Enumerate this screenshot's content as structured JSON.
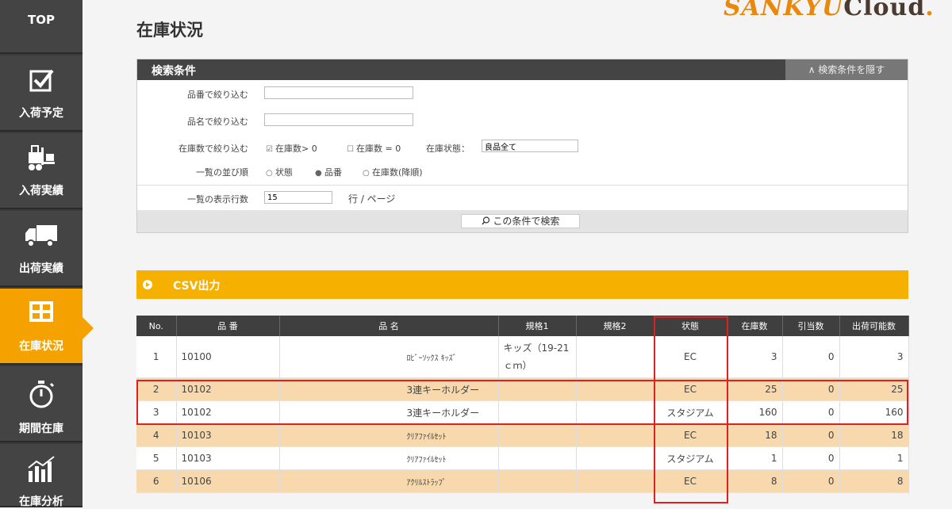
{
  "sidebar": {
    "items": [
      {
        "label": "TOP",
        "icon": "top"
      },
      {
        "label": "入荷予定",
        "icon": "checkbox-icon"
      },
      {
        "label": "入荷実績",
        "icon": "forklift-icon"
      },
      {
        "label": "出荷実績",
        "icon": "truck-icon"
      },
      {
        "label": "在庫状況",
        "icon": "grid-icon",
        "active": true
      },
      {
        "label": "期間在庫",
        "icon": "stopwatch-icon"
      },
      {
        "label": "在庫分析",
        "icon": "bar-chart-icon"
      }
    ]
  },
  "logo": {
    "part1": "SANKYU",
    "part2": "Cloud",
    "dot": "."
  },
  "page_title": "在庫状況",
  "search_panel": {
    "title": "検索条件",
    "hide_button": "∧ 検索条件を隠す",
    "rows": {
      "part_no_label": "品番で絞り込む",
      "part_name_label": "品名で絞り込む",
      "stock_label": "在庫数で絞り込む",
      "sort_label": "一覧の並び順",
      "page_size_label": "一覧の表示行数"
    },
    "part_no_value": "",
    "part_name_value": "",
    "stock_filters": [
      "在庫数> 0",
      "在庫数 = 0"
    ],
    "stock_filter_marks": [
      "☑",
      "☐"
    ],
    "status_label": "在庫状態：",
    "status_value": "良品全て",
    "sort_options": [
      "状態",
      "品番",
      "在庫数(降順)"
    ],
    "sort_marks": [
      "○",
      "●",
      "○"
    ],
    "page_size_value": "15",
    "page_size_unit": "行 / ページ",
    "search_button": "この条件で検索"
  },
  "csv_button": "CSV出力",
  "table": {
    "headers": [
      "No.",
      "品 番",
      "品 名",
      "規格1",
      "規格2",
      "状態",
      "在庫数",
      "引当数",
      "出荷可能数"
    ],
    "rows": [
      {
        "no": "1",
        "part_no": "10100",
        "name": "ﾛﾋﾞｰｿｯｸｽ ｷｯｽﾞ",
        "spec1": "キッズ（19-21ｃｍ）",
        "spec2": "",
        "status": "EC",
        "stock": "3",
        "alloc": "0",
        "avail": "3"
      },
      {
        "no": "2",
        "part_no": "10102",
        "name": "3連キーホルダー",
        "spec1": "",
        "spec2": "",
        "status": "EC",
        "stock": "25",
        "alloc": "0",
        "avail": "25"
      },
      {
        "no": "3",
        "part_no": "10102",
        "name": "3連キーホルダー",
        "spec1": "",
        "spec2": "",
        "status": "スタジアム",
        "stock": "160",
        "alloc": "0",
        "avail": "160"
      },
      {
        "no": "4",
        "part_no": "10103",
        "name": "ｸﾘｱﾌｧｲﾙｾｯﾄ",
        "spec1": "",
        "spec2": "",
        "status": "EC",
        "stock": "18",
        "alloc": "0",
        "avail": "18"
      },
      {
        "no": "5",
        "part_no": "10103",
        "name": "ｸﾘｱﾌｧｲﾙｾｯﾄ",
        "spec1": "",
        "spec2": "",
        "status": "スタジアム",
        "stock": "1",
        "alloc": "0",
        "avail": "1"
      },
      {
        "no": "6",
        "part_no": "10106",
        "name": "ｱｸﾘﾙｽﾄﾗｯﾌﾟ",
        "spec1": "",
        "spec2": "",
        "status": "EC",
        "stock": "8",
        "alloc": "0",
        "avail": "8"
      }
    ]
  },
  "colors": {
    "accent": "#f5a200",
    "highlight_row": "#f7d9ad",
    "dark": "#3f3f3f",
    "annotation": "#e02020"
  }
}
